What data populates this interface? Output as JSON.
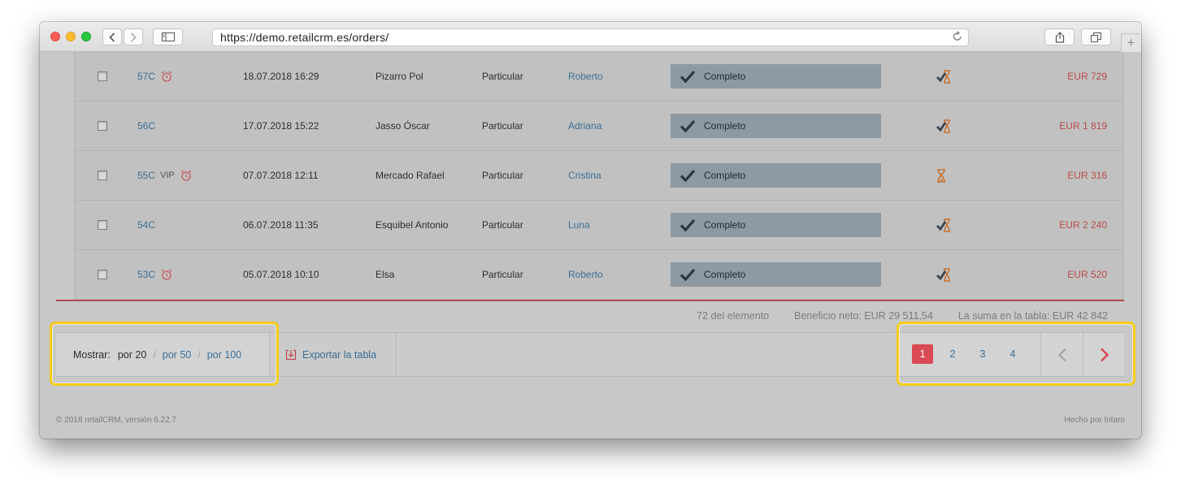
{
  "browser": {
    "url": "https://demo.retailcrm.es/orders/",
    "reload_icon": "reload-icon"
  },
  "orders": [
    {
      "number": "57C",
      "vip": "",
      "alarm": true,
      "date": "18.07.2018 16:29",
      "customer": "Pizarro Pol",
      "type": "Particular",
      "manager": "Roberto",
      "status": "Completo",
      "payment_icon": "check-hourglass-icon",
      "sum": "EUR 729"
    },
    {
      "number": "56C",
      "vip": "",
      "alarm": false,
      "date": "17.07.2018 15:22",
      "customer": "Jasso Óscar",
      "type": "Particular",
      "manager": "Adriana",
      "status": "Completo",
      "payment_icon": "check-hourglass-icon",
      "sum": "EUR 1 819"
    },
    {
      "number": "55C",
      "vip": "VIP",
      "alarm": true,
      "date": "07.07.2018 12:11",
      "customer": "Mercado Rafael",
      "type": "Particular",
      "manager": "Cristina",
      "status": "Completo",
      "payment_icon": "hourglass-icon",
      "sum": "EUR 316"
    },
    {
      "number": "54C",
      "vip": "",
      "alarm": false,
      "date": "06.07.2018 11:35",
      "customer": "Esquibel Antonio",
      "type": "Particular",
      "manager": "Luna",
      "status": "Completo",
      "payment_icon": "check-hourglass-icon",
      "sum": "EUR 2 240"
    },
    {
      "number": "53C",
      "vip": "",
      "alarm": true,
      "date": "05.07.2018 10:10",
      "customer": "Elsa",
      "type": "Particular",
      "manager": "Roberto",
      "status": "Completo",
      "payment_icon": "check-hourglass-icon",
      "sum": "EUR 520"
    }
  ],
  "summary": {
    "count": "72 del elemento",
    "profit": "Beneficio neto: EUR 29 511,54",
    "total": "La suma en la tabla: EUR 42 842"
  },
  "toolbar": {
    "show_label": "Mostrar:",
    "per_page_current": "por 20",
    "sep": "/",
    "per_page_50": "por 50",
    "per_page_100": "por 100",
    "export_label": "Exportar la tabla"
  },
  "pagination": {
    "pages": [
      "1",
      "2",
      "3",
      "4"
    ],
    "current": "1"
  },
  "footer": {
    "copyright": "© 2018 retailCRM, versión 6.22.7",
    "made_by": "Hecho por Intaro"
  },
  "colors": {
    "highlight": "#f5cc16",
    "accent_red": "#d94a55",
    "link_blue": "#3b6e94"
  }
}
